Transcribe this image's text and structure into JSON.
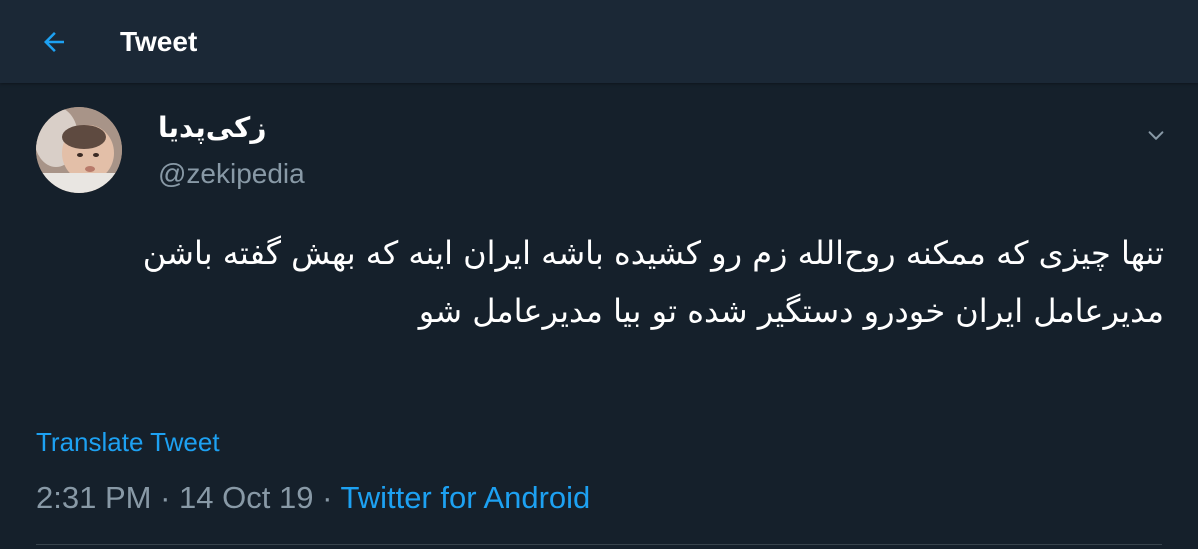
{
  "header": {
    "title": "Tweet",
    "back_icon": "arrow-left-icon"
  },
  "author": {
    "display_name": "زکی‌پدیا",
    "handle": "@zekipedia",
    "avatar": "avatar-photo"
  },
  "tweet": {
    "text": "تنها چیزی که ممکنه روح‌الله زم رو کشیده باشه ایران اینه که بهش گفته باشن مدیرعامل ایران خودرو دستگیر شده تو بیا مدیرعامل شو",
    "translate_label": "Translate Tweet",
    "time": "2:31 PM",
    "separator": "·",
    "date": "14 Oct 19",
    "source": "Twitter for Android"
  },
  "colors": {
    "background": "#15202b",
    "header_background": "#1b2836",
    "accent": "#1da1f2",
    "secondary_text": "#8899a6",
    "primary_text": "#ffffff"
  }
}
